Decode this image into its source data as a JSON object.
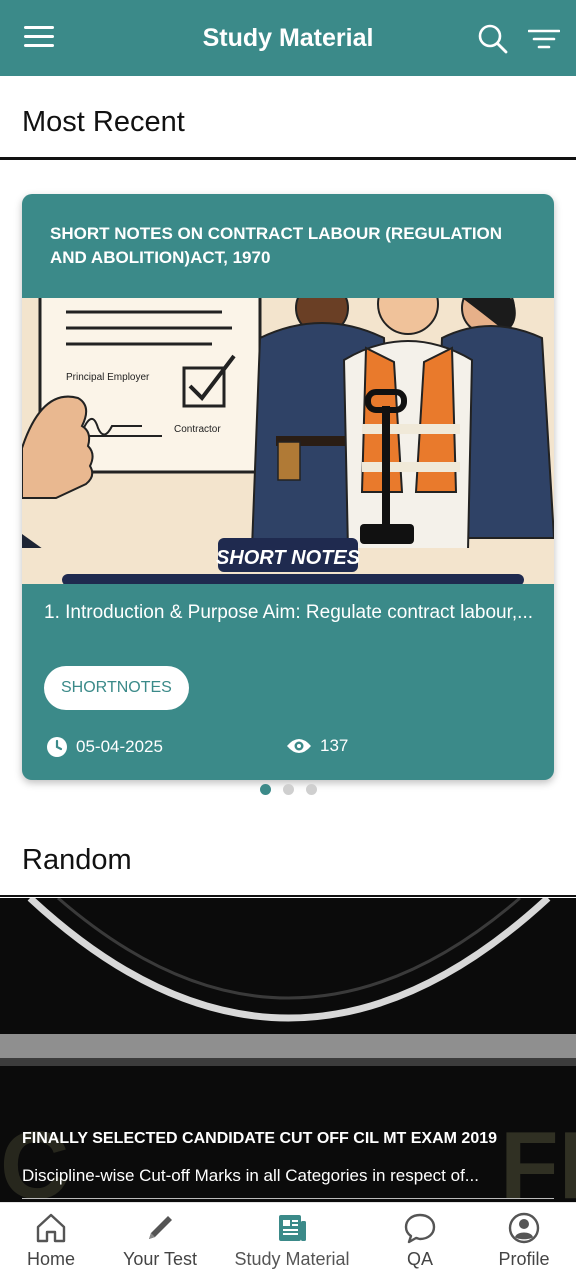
{
  "appbar": {
    "title": "Study Material",
    "menu_icon": "hamburger-menu-icon",
    "search_icon": "search-icon",
    "filter_icon": "filter-icon"
  },
  "sections": {
    "most_recent": "Most Recent",
    "random": "Random"
  },
  "recent_card": {
    "title": "SHORT NOTES ON CONTRACT LABOUR (REGULATION AND ABOLITION)ACT, 1970",
    "image_labels": {
      "principal_employer": "Principal Employer",
      "contractor": "Contractor",
      "badge": "SHORT NOTES"
    },
    "excerpt": "1. Introduction & Purpose Aim: Regulate contract labour,...",
    "tag": "SHORTNOTES",
    "date": "05-04-2025",
    "views": "137"
  },
  "carousel": {
    "count": 3,
    "active_index": 0
  },
  "random_card": {
    "title": "FINALLY SELECTED CANDIDATE CUT OFF CIL MT EXAM 2019",
    "excerpt": "Discipline-wise Cut-off Marks in all Categories in respect of..."
  },
  "bottom_nav": [
    {
      "label": "Home",
      "icon": "home-icon"
    },
    {
      "label": "Your Test",
      "icon": "pencil-icon"
    },
    {
      "label": "Study Material",
      "icon": "newspaper-icon"
    },
    {
      "label": "QA",
      "icon": "chat-bubble-icon"
    },
    {
      "label": "Profile",
      "icon": "user-circle-icon"
    }
  ],
  "colors": {
    "primary": "#3b8a89",
    "active_nav": "#3b8a89",
    "nav_text": "#444444"
  }
}
